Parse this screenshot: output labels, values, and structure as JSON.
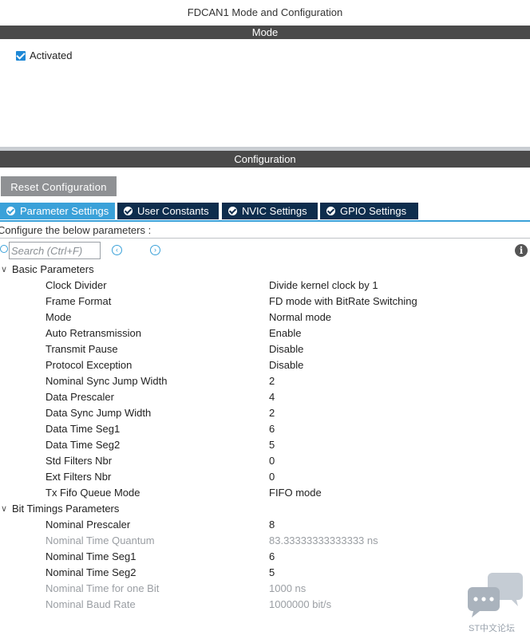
{
  "window": {
    "title": "FDCAN1 Mode and Configuration"
  },
  "mode": {
    "header": "Mode",
    "activated_label": "Activated",
    "activated_checked": true
  },
  "configuration": {
    "header": "Configuration",
    "reset_label": "Reset Configuration",
    "tabs": [
      {
        "label": "Parameter Settings",
        "active": true
      },
      {
        "label": "User Constants",
        "active": false
      },
      {
        "label": "NVIC Settings",
        "active": false
      },
      {
        "label": "GPIO Settings",
        "active": false
      }
    ],
    "configure_text": "Configure the below parameters :",
    "search_placeholder": "Search (Ctrl+F)",
    "groups": [
      {
        "label": "Basic Parameters",
        "rows": [
          {
            "key": "Clock Divider",
            "value": "Divide kernel clock by 1"
          },
          {
            "key": "Frame Format",
            "value": "FD mode with BitRate Switching"
          },
          {
            "key": "Mode",
            "value": "Normal mode"
          },
          {
            "key": "Auto Retransmission",
            "value": "Enable"
          },
          {
            "key": "Transmit Pause",
            "value": "Disable"
          },
          {
            "key": "Protocol Exception",
            "value": "Disable"
          },
          {
            "key": "Nominal Sync Jump Width",
            "value": "2"
          },
          {
            "key": "Data Prescaler",
            "value": "4"
          },
          {
            "key": "Data Sync Jump Width",
            "value": "2"
          },
          {
            "key": "Data Time Seg1",
            "value": "6"
          },
          {
            "key": "Data Time Seg2",
            "value": "5"
          },
          {
            "key": "Std Filters Nbr",
            "value": "0"
          },
          {
            "key": "Ext Filters Nbr",
            "value": "0"
          },
          {
            "key": "Tx Fifo Queue Mode",
            "value": "FIFO mode"
          }
        ]
      },
      {
        "label": "Bit Timings Parameters",
        "rows": [
          {
            "key": "Nominal Prescaler",
            "value": "8"
          },
          {
            "key": "Nominal Time Quantum",
            "value": "83.33333333333333 ns",
            "disabled": true
          },
          {
            "key": "Nominal Time Seg1",
            "value": "6"
          },
          {
            "key": "Nominal Time Seg2",
            "value": "5"
          },
          {
            "key": "Nominal Time for one Bit",
            "value": "1000 ns",
            "disabled": true
          },
          {
            "key": "Nominal Baud Rate",
            "value": "1000000 bit/s",
            "disabled": true
          }
        ]
      }
    ]
  },
  "watermark": {
    "text": "ST中文论坛"
  },
  "colors": {
    "accent": "#3aa1d9",
    "tab_bg": "#0e2d4d",
    "bar_bg": "#4a4a4a",
    "button_bg": "#8f9194"
  }
}
